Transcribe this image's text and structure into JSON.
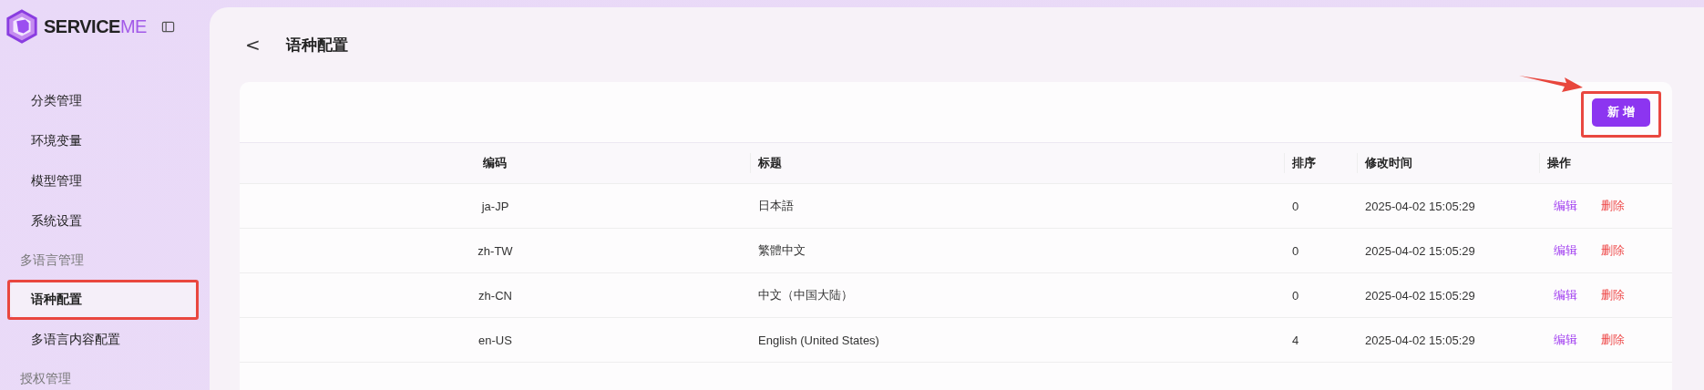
{
  "logo": {
    "text": "SERVICE",
    "accent": "ME"
  },
  "sidebar": {
    "items": [
      {
        "kind": "item",
        "label": "分类管理",
        "selected": false,
        "annotated": false
      },
      {
        "kind": "item",
        "label": "环境变量",
        "selected": false,
        "annotated": false
      },
      {
        "kind": "item",
        "label": "模型管理",
        "selected": false,
        "annotated": false
      },
      {
        "kind": "item",
        "label": "系统设置",
        "selected": false,
        "annotated": false
      },
      {
        "kind": "group",
        "label": "多语言管理"
      },
      {
        "kind": "item",
        "label": "语种配置",
        "selected": true,
        "annotated": true
      },
      {
        "kind": "item",
        "label": "多语言内容配置",
        "selected": false,
        "annotated": false
      },
      {
        "kind": "group",
        "label": "授权管理"
      }
    ]
  },
  "page": {
    "back": "<",
    "title": "语种配置"
  },
  "toolbar": {
    "add_button": {
      "label": "新 增",
      "annotated": true
    }
  },
  "table": {
    "columns": [
      "编码",
      "标题",
      "排序",
      "修改时间",
      "操作"
    ],
    "rows": [
      {
        "code": "ja-JP",
        "title": "日本語",
        "order": "0",
        "modified": "2025-04-02 15:05:29",
        "actions": [
          "编辑",
          "删除"
        ]
      },
      {
        "code": "zh-TW",
        "title": "繁體中文",
        "order": "0",
        "modified": "2025-04-02 15:05:29",
        "actions": [
          "编辑",
          "删除"
        ]
      },
      {
        "code": "zh-CN",
        "title": "中文（中国大陆）",
        "order": "0",
        "modified": "2025-04-02 15:05:29",
        "actions": [
          "编辑",
          "删除"
        ]
      },
      {
        "code": "en-US",
        "title": "English (United States)",
        "order": "4",
        "modified": "2025-04-02 15:05:29",
        "actions": [
          "编辑",
          "删除"
        ]
      }
    ]
  }
}
